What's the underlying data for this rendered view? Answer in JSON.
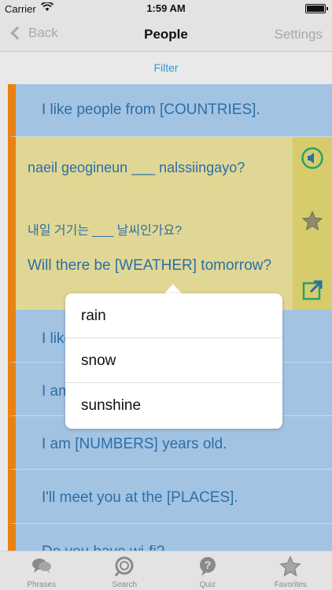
{
  "status_bar": {
    "carrier": "Carrier",
    "time": "1:59 AM"
  },
  "nav": {
    "back_label": "Back",
    "title": "People",
    "settings_label": "Settings"
  },
  "filter_label": "Filter",
  "phrases": {
    "row1": "I like people from [COUNTRIES].",
    "expanded": {
      "romanized": "naeil geogineun ___ nalssiingayo?",
      "korean": "내일 거기는 ___ 날씨인가요?",
      "english": "Will there be [WEATHER] tomorrow?"
    },
    "row3": "I like",
    "row4": "I am",
    "row5": "I am [NUMBERS] years old.",
    "row6": "I'll meet you at the [PLACES].",
    "row7": "Do you have wi-fi?"
  },
  "popup": {
    "options": [
      "rain",
      "snow",
      "sunshine"
    ]
  },
  "tabs": [
    {
      "label": "Phrases",
      "icon": "speech-bubbles-icon"
    },
    {
      "label": "Search",
      "icon": "search-icon"
    },
    {
      "label": "Quiz",
      "icon": "quiz-icon"
    },
    {
      "label": "Favorites",
      "icon": "star-icon"
    }
  ],
  "colors": {
    "accent_orange": "#e98212",
    "row_blue": "#a3c3e3",
    "row_yellow": "#e1d794",
    "text_blue": "#2a6fa8",
    "link_blue": "#2f9ad6"
  }
}
